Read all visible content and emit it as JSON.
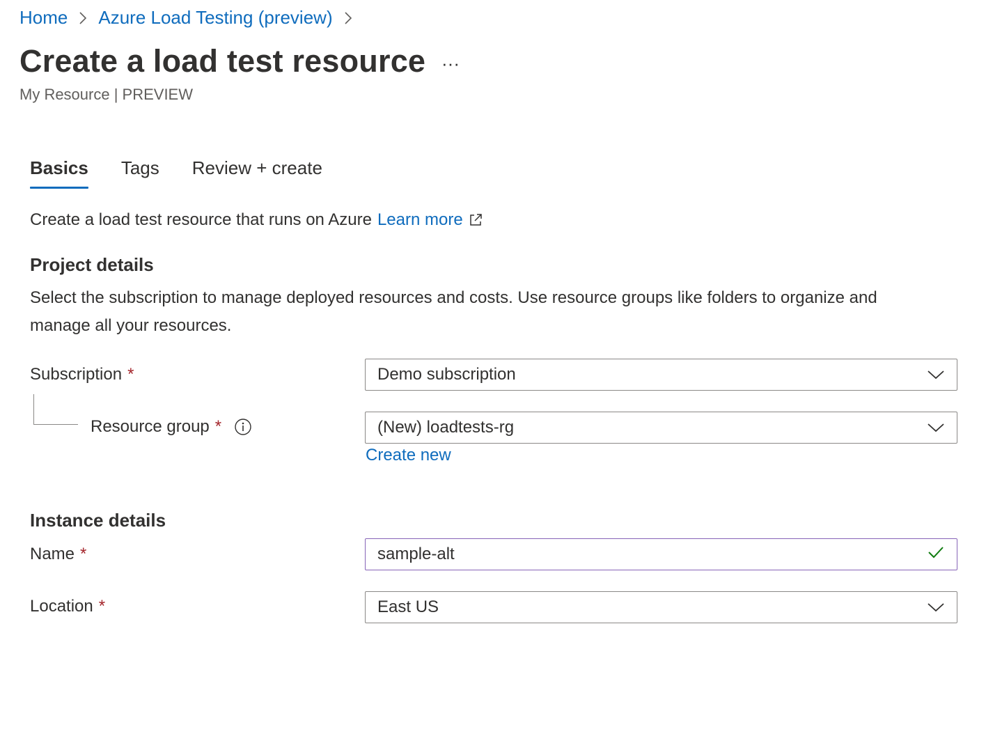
{
  "breadcrumb": {
    "items": [
      "Home",
      "Azure Load Testing (preview)"
    ]
  },
  "header": {
    "title": "Create a load test resource",
    "more_label": "···",
    "subtitle": "My Resource | PREVIEW"
  },
  "tabs": [
    {
      "label": "Basics",
      "active": true
    },
    {
      "label": "Tags",
      "active": false
    },
    {
      "label": "Review + create",
      "active": false
    }
  ],
  "intro": {
    "text": "Create a load test resource that runs on Azure",
    "link": "Learn more"
  },
  "project": {
    "title": "Project details",
    "description": "Select the subscription to manage deployed resources and costs. Use resource groups like folders to organize and manage all your resources.",
    "subscription": {
      "label": "Subscription",
      "required_mark": "*",
      "value": "Demo subscription"
    },
    "resource_group": {
      "label": "Resource group",
      "required_mark": "*",
      "value": "(New) loadtests-rg",
      "create_new": "Create new"
    }
  },
  "instance": {
    "title": "Instance details",
    "name": {
      "label": "Name",
      "required_mark": "*",
      "value": "sample-alt"
    },
    "location": {
      "label": "Location",
      "required_mark": "*",
      "value": "East US"
    }
  },
  "colors": {
    "link": "#0f6cbd",
    "required": "#a4262c",
    "valid": "#107c10",
    "focus_border": "#8764b8"
  },
  "icons": {
    "breadcrumb_separator": "chevron-right-icon",
    "external_link": "external-link-icon",
    "info": "info-icon",
    "dropdown": "chevron-down-icon",
    "valid": "checkmark-icon"
  }
}
